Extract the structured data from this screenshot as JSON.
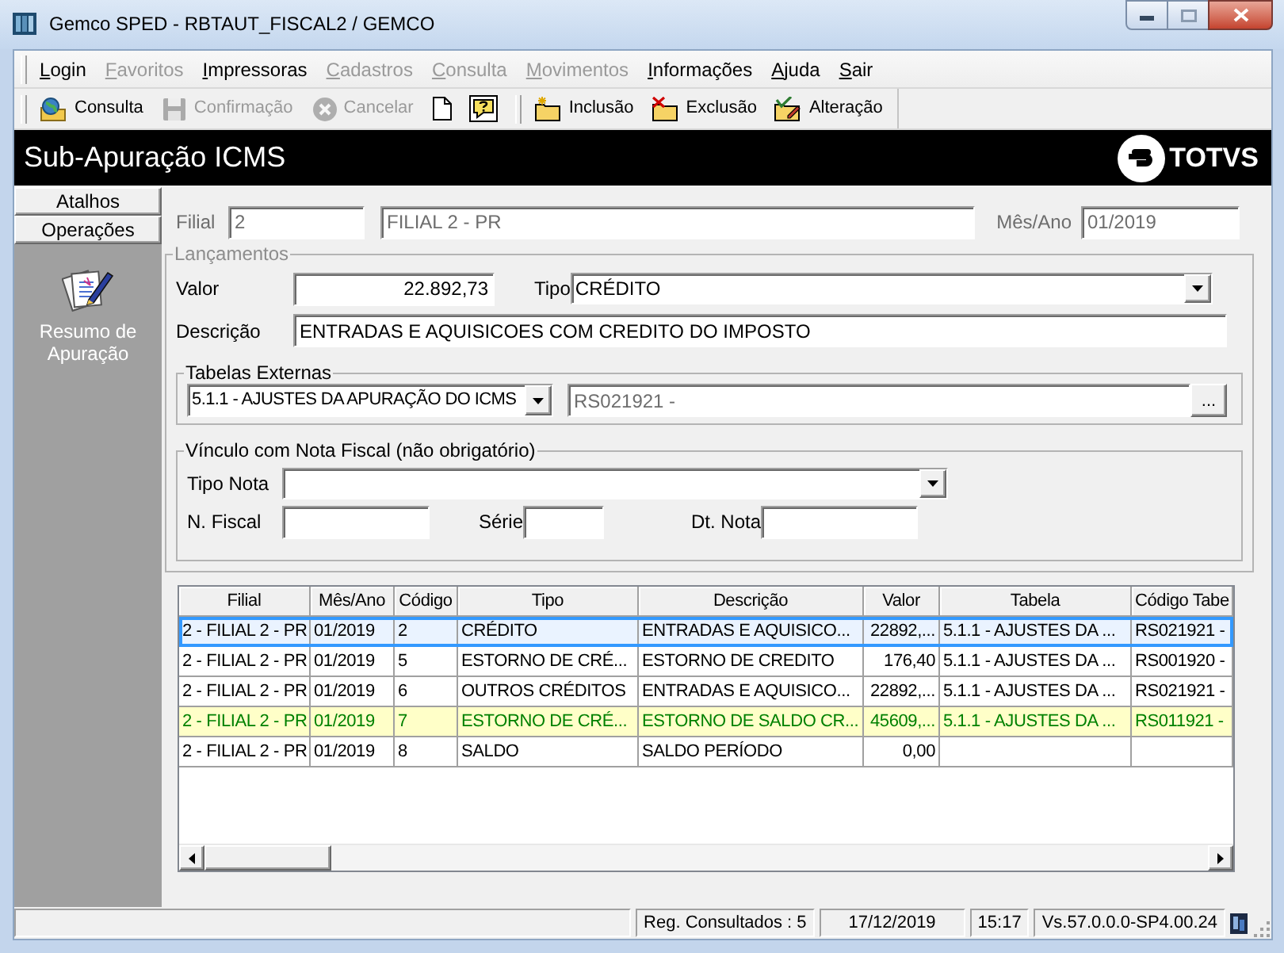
{
  "window": {
    "title": "Gemco SPED - RBTAUT_FISCAL2 / GEMCO"
  },
  "menu": [
    {
      "label": "Login",
      "disabled": false
    },
    {
      "label": "Favoritos",
      "disabled": true
    },
    {
      "label": "Impressoras",
      "disabled": false
    },
    {
      "label": "Cadastros",
      "disabled": true
    },
    {
      "label": "Consulta",
      "disabled": true
    },
    {
      "label": "Movimentos",
      "disabled": true
    },
    {
      "label": "Informações",
      "disabled": false
    },
    {
      "label": "Ajuda",
      "disabled": false
    },
    {
      "label": "Sair",
      "disabled": false
    }
  ],
  "toolbar": {
    "actions": [
      {
        "label": "Consulta",
        "disabled": false
      },
      {
        "label": "Confirmação",
        "disabled": true
      },
      {
        "label": "Cancelar",
        "disabled": true
      }
    ],
    "edit_actions": [
      {
        "label": "Inclusão",
        "disabled": false
      },
      {
        "label": "Exclusão",
        "disabled": false
      },
      {
        "label": "Alteração",
        "disabled": false
      }
    ]
  },
  "header": {
    "title": "Sub-Apuração ICMS",
    "logo": "TOTVS"
  },
  "sidebar": {
    "tabs": [
      {
        "label": "Atalhos"
      },
      {
        "label": "Operações"
      }
    ],
    "items": [
      {
        "label": "Resumo de Apuração"
      }
    ]
  },
  "filter": {
    "filial": {
      "label": "Filial",
      "code": "2",
      "name": "FILIAL 2 - PR",
      "disabled": true
    },
    "period": {
      "label": "Mês/Ano",
      "value": "01/2019",
      "disabled": true
    }
  },
  "lancamentos": {
    "title": "Lançamentos",
    "disabled": true,
    "valor": {
      "label": "Valor",
      "value": "22.892,73"
    },
    "tipo": {
      "label": "Tipo",
      "value": "CRÉDITO"
    },
    "descricao": {
      "label": "Descrição",
      "value": "ENTRADAS E AQUISICOES COM CREDITO DO IMPOSTO"
    },
    "tabelas_externas": {
      "title": "Tabelas Externas",
      "table": "5.1.1 - AJUSTES DA APURAÇÃO DO ICMS",
      "code": {
        "value": "RS021921 -",
        "disabled": true
      },
      "browse": "..."
    },
    "vinculo_nota": {
      "title": "Vínculo com Nota Fiscal (não obrigatório)",
      "tipo_nota": "Tipo Nota",
      "n_fiscal": "N. Fiscal",
      "serie": "Série",
      "dt_nota": "Dt. Nota"
    }
  },
  "table": {
    "columns": [
      "Filial",
      "Mês/Ano",
      "Código",
      "Tipo",
      "Descrição",
      "Valor",
      "Tabela",
      "Código Tabe"
    ],
    "rows": [
      {
        "cells": [
          "2 - FILIAL 2 - PR",
          "01/2019",
          "2",
          "CRÉDITO",
          "ENTRADAS E AQUISICO...",
          "22892,...",
          "5.1.1 - AJUSTES DA ...",
          "RS021921 -"
        ],
        "selected": true,
        "highlighted": false
      },
      {
        "cells": [
          "2 - FILIAL 2 - PR",
          "01/2019",
          "5",
          "ESTORNO DE CRÉ...",
          "ESTORNO DE CREDITO",
          "176,40",
          "5.1.1 - AJUSTES DA ...",
          "RS001920 -"
        ],
        "selected": false,
        "highlighted": false
      },
      {
        "cells": [
          "2 - FILIAL 2 - PR",
          "01/2019",
          "6",
          "OUTROS CRÉDITOS",
          "ENTRADAS E AQUISICO...",
          "22892,...",
          "5.1.1 - AJUSTES DA ...",
          "RS021921 -"
        ],
        "selected": false,
        "highlighted": false
      },
      {
        "cells": [
          "2 - FILIAL 2 - PR",
          "01/2019",
          "7",
          "ESTORNO DE CRÉ...",
          "ESTORNO DE SALDO CR...",
          "45609,...",
          "5.1.1 - AJUSTES DA ...",
          "RS011921 -"
        ],
        "selected": false,
        "highlighted": true
      },
      {
        "cells": [
          "2 - FILIAL 2 - PR",
          "01/2019",
          "8",
          "SALDO",
          "SALDO PERÍODO",
          "0,00"
        ],
        "selected": false,
        "highlighted": false
      }
    ]
  },
  "status_bar": {
    "records": "Reg. Consultados : 5",
    "date": "17/12/2019",
    "time": "15:17",
    "version": "Vs.57.0.0.0-SP4.00.24"
  }
}
